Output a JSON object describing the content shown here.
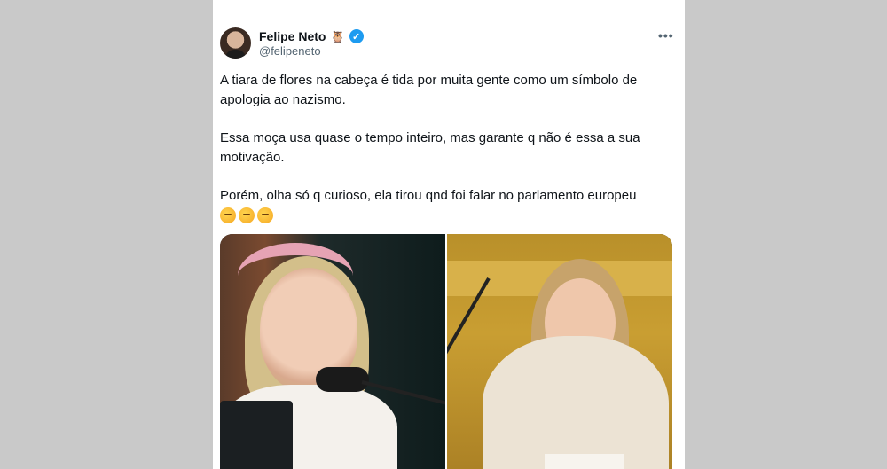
{
  "tweet": {
    "author_name": "Felipe Neto",
    "name_emoji": "🦉",
    "handle": "@felipeneto",
    "more_label": "•••",
    "paragraphs": [
      "A tiara de flores na cabeça é tida por muita gente como um símbolo de apologia ao nazismo.",
      "Essa moça usa quase o tempo inteiro, mas garante q não é essa a sua motivação.",
      "Porém, olha só q curioso, ela tirou qnd foi falar no parlamento europeu"
    ],
    "emoji_icons": [
      "thinking-face",
      "thinking-face",
      "thinking-face"
    ],
    "verified_color": "#1d9bf0"
  },
  "icons": {
    "verified": "verified-badge-icon",
    "more": "more-options-icon"
  }
}
